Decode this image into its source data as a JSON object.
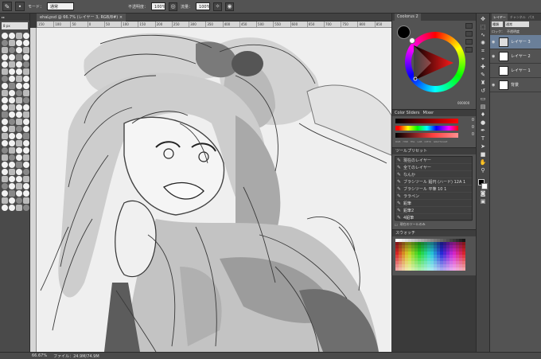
{
  "options_bar": {
    "mode_label": "モード：",
    "mode_value": "通常",
    "opacity_label": "不透明度：",
    "opacity_value": "100%",
    "flow_label": "流量：",
    "flow_value": "100%"
  },
  "brush_panel": {
    "size_value": "8 px"
  },
  "document": {
    "tab_title": "ehaLpsd @ 66.7% (レイヤー 3, RGB/8#) ×",
    "ruler_ticks": [
      "150",
      "100",
      "50",
      "0",
      "50",
      "100",
      "150",
      "200",
      "250",
      "300",
      "350",
      "400",
      "450",
      "500",
      "550",
      "600",
      "650",
      "700",
      "750",
      "800",
      "850"
    ]
  },
  "status": {
    "zoom": "66.67%",
    "file_info": "ファイル：24.9M/74.9M"
  },
  "color_panel": {
    "tab": "Coolorus 2",
    "hex_value": "000000"
  },
  "slider_panel": {
    "tab1": "Color Sliders",
    "tab2": "Mixer",
    "values": [
      "0",
      "0",
      "0"
    ],
    "modes": [
      "RGB",
      "HSB",
      "HSL",
      "LAB",
      "CMYK",
      "GRAYSCALE"
    ]
  },
  "tool_presets": {
    "title": "ツールプリセット",
    "items": [
      "現在のレイヤー",
      "全てのレイヤー",
      "なんか",
      "ブラシツール 鉛円 (ハード) 12A 1",
      "ブラシツール 平筆 10 1",
      "ララペン",
      "鉛筆",
      "鉛筆2",
      "4鉛筆"
    ],
    "footer": "現在のツールのみ"
  },
  "swatches": {
    "title": "スウォッチ"
  },
  "layers_panel": {
    "tabs": [
      "レイヤー",
      "チャンネル",
      "パス"
    ],
    "kind_value": "種類",
    "mode_value": "通常",
    "opacity_label": "不透明度",
    "lock_label": "ロック：",
    "layers": [
      {
        "name": "レイヤー 3",
        "selected": true
      },
      {
        "name": "レイヤー 2",
        "selected": false
      },
      {
        "name": "レイヤー 1",
        "selected": false
      },
      {
        "name": "背景",
        "selected": false
      }
    ]
  },
  "colors": {
    "panel_bg": "#535353",
    "selected_layer": "#6a7f99"
  }
}
